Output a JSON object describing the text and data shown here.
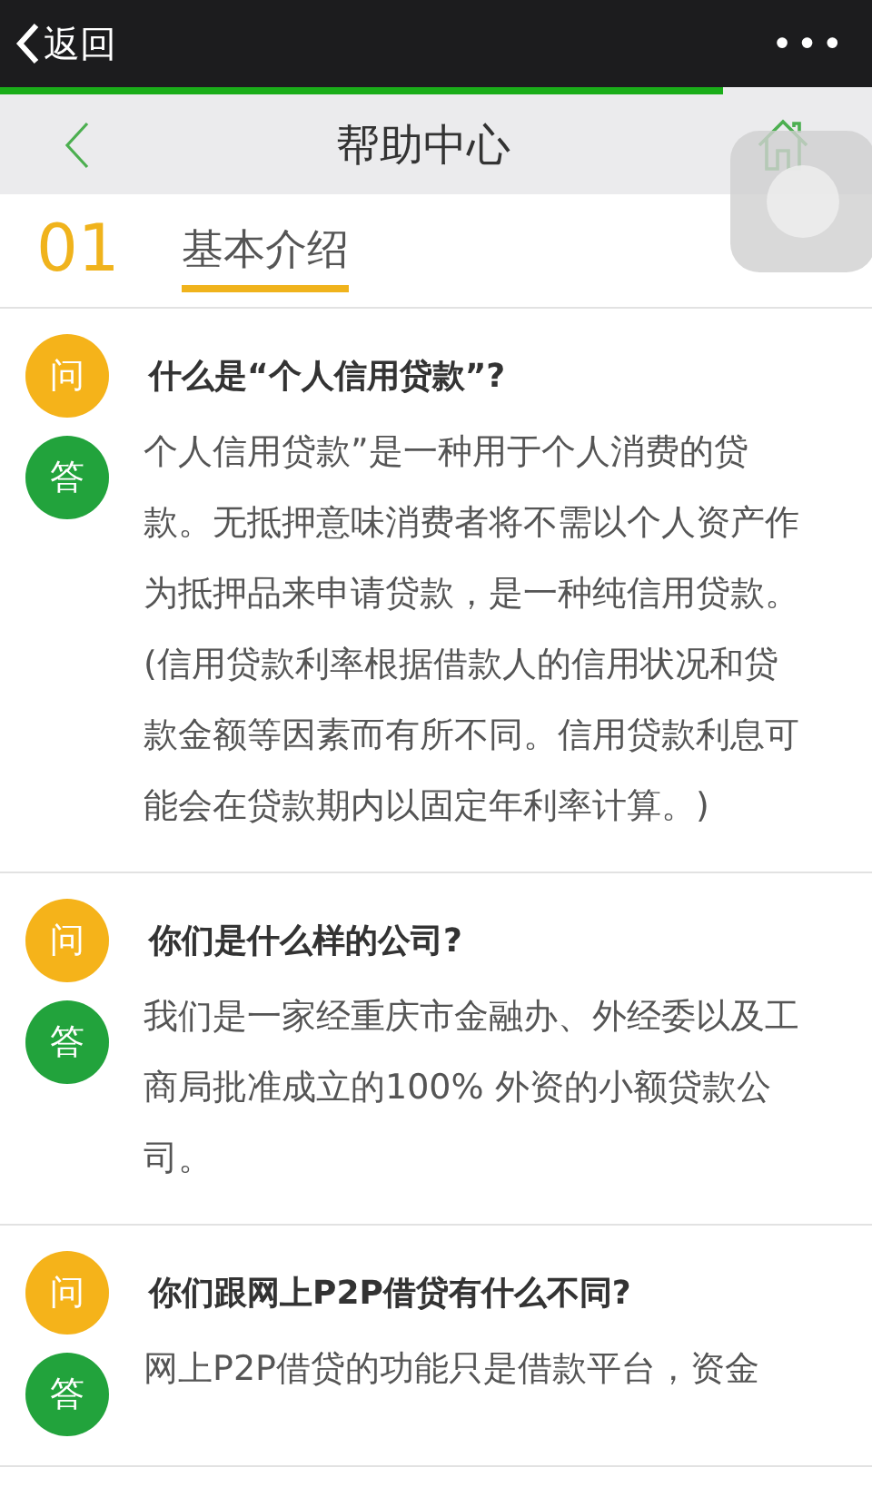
{
  "top_bar": {
    "back_label": "返回",
    "more": "•••"
  },
  "loading": {
    "level": 0.83
  },
  "header": {
    "title": "帮助中心"
  },
  "section": {
    "number": "01",
    "title": "基本介绍"
  },
  "faq": [
    {
      "q_badge": "问",
      "question": "什么是“个人信用贷款”?",
      "a_badge": "答",
      "answer": "个人信用贷款”是一种用于个人消费的贷款。无抵押意味消费者将不需以个人资产作为抵押品来申请贷款，是一种纯信用贷款。(信用贷款利率根据借款人的信用状况和贷款金额等因素而有所不同。信用贷款利息可能会在贷款期内以固定年利率计算。)"
    },
    {
      "q_badge": "问",
      "question": "你们是什么样的公司?",
      "a_badge": "答",
      "answer": "我们是一家经重庆市金融办、外经委以及工商局批准成立的100% 外资的小额贷款公司。"
    },
    {
      "q_badge": "问",
      "question": "你们跟网上P2P借贷有什么不同?",
      "a_badge": "答",
      "answer": "网上P2P借贷的功能只是借款平台，资金"
    }
  ]
}
